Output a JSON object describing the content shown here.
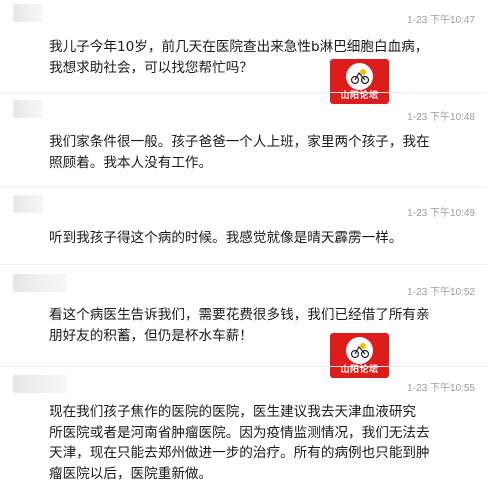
{
  "messages": [
    {
      "time": "1-23 下午10:47",
      "text": "我儿子今年10岁，前几天在医院查出来急性b淋巴细胞白血病，\n我想求助社会，可以找您帮忙吗？"
    },
    {
      "time": "1-23 下午10:48",
      "text": "我们家条件很一般。孩子爸爸一个人上班，家里两个孩子，我在\n照顾着。我本人没有工作。"
    },
    {
      "time": "1-23 下午10:49",
      "text": "听到我孩子得这个病的时候。我感觉就像是晴天霹雳一样。"
    },
    {
      "time": "1-23 下午10:52",
      "text": "看这个病医生告诉我们，需要花费很多钱，我们已经借了所有亲\n朋好友的积蓄，但仍是杯水车薪！"
    },
    {
      "time": "1-23 下午10:55",
      "text": "现在我们孩子焦作的医院的医院，医生建议我去天津血液研究\n所医院或者是河南省肿瘤医院。因为疫情监测情况，我们无法去\n天津，现在只能去郑州做进一步的治疗。所有的病例也只能到肿\n瘤医院以后，医院重新做。"
    }
  ],
  "watermark": {
    "label": "山阳论坛",
    "icon": "shanyang-forum-logo-icon"
  }
}
